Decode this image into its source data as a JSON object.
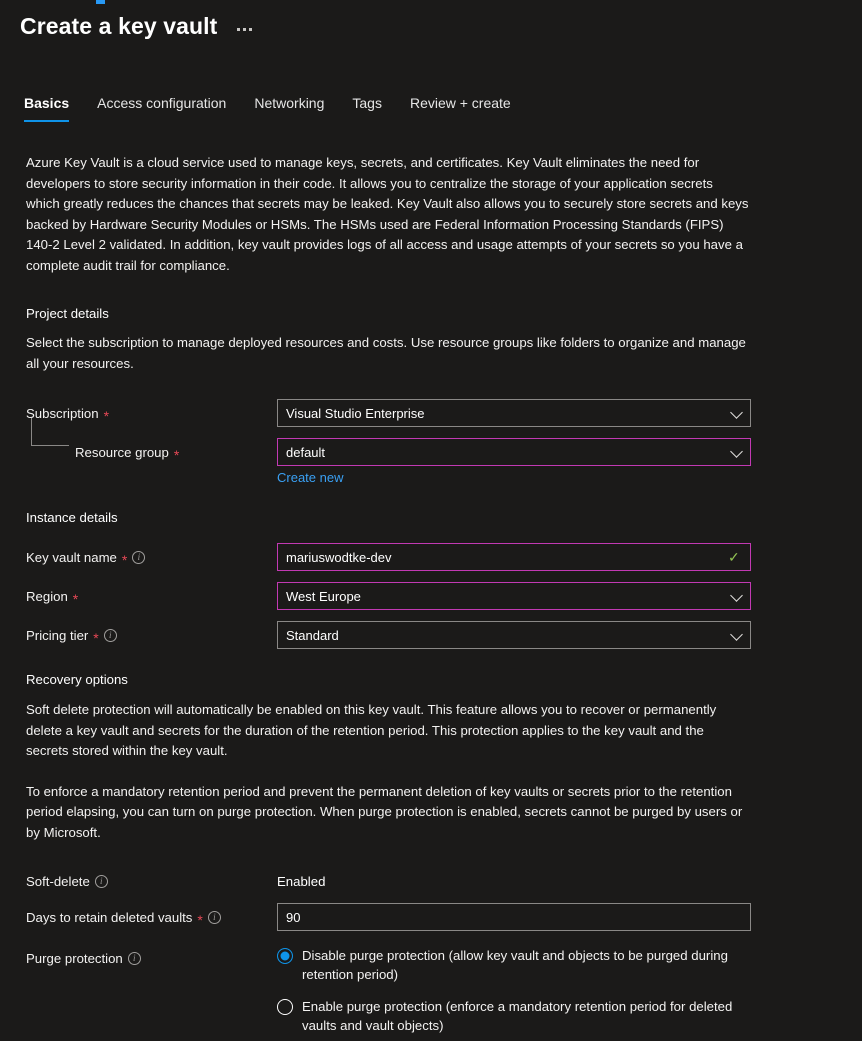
{
  "header": {
    "title": "Create a key vault",
    "more_menu": "..."
  },
  "tabs": [
    {
      "label": "Basics",
      "active": true
    },
    {
      "label": "Access configuration",
      "active": false
    },
    {
      "label": "Networking",
      "active": false
    },
    {
      "label": "Tags",
      "active": false
    },
    {
      "label": "Review + create",
      "active": false
    }
  ],
  "intro": "Azure Key Vault is a cloud service used to manage keys, secrets, and certificates. Key Vault eliminates the need for developers to store security information in their code. It allows you to centralize the storage of your application secrets which greatly reduces the chances that secrets may be leaked. Key Vault also allows you to securely store secrets and keys backed by Hardware Security Modules or HSMs. The HSMs used are Federal Information Processing Standards (FIPS) 140-2 Level 2 validated. In addition, key vault provides logs of all access and usage attempts of your secrets so you have a complete audit trail for compliance.",
  "project_details": {
    "heading": "Project details",
    "description": "Select the subscription to manage deployed resources and costs. Use resource groups like folders to organize and manage all your resources.",
    "subscription": {
      "label": "Subscription",
      "required": "*",
      "value": "Visual Studio Enterprise"
    },
    "resource_group": {
      "label": "Resource group",
      "required": "*",
      "value": "default",
      "create_new_link": "Create new"
    }
  },
  "instance_details": {
    "heading": "Instance details",
    "key_vault_name": {
      "label": "Key vault name",
      "required": "*",
      "value": "mariuswodtke-dev",
      "validation_icon": "check-icon"
    },
    "region": {
      "label": "Region",
      "required": "*",
      "value": "West Europe"
    },
    "pricing_tier": {
      "label": "Pricing tier",
      "required": "*",
      "value": "Standard"
    }
  },
  "recovery_options": {
    "heading": "Recovery options",
    "paragraph_1": "Soft delete protection will automatically be enabled on this key vault. This feature allows you to recover or permanently delete a key vault and secrets for the duration of the retention period. This protection applies to the key vault and the secrets stored within the key vault.",
    "paragraph_2": "To enforce a mandatory retention period and prevent the permanent deletion of key vaults or secrets prior to the retention period elapsing, you can turn on purge protection. When purge protection is enabled, secrets cannot be purged by users or by Microsoft.",
    "soft_delete": {
      "label": "Soft-delete",
      "value": "Enabled"
    },
    "days_to_retain": {
      "label": "Days to retain deleted vaults",
      "required": "*",
      "value": "90"
    },
    "purge_protection": {
      "label": "Purge protection",
      "options": [
        {
          "label": "Disable purge protection (allow key vault and objects to be purged during retention period)",
          "selected": true
        },
        {
          "label": "Enable purge protection (enforce a mandatory retention period for deleted vaults and vault objects)",
          "selected": false
        }
      ]
    }
  },
  "colors": {
    "background": "#1b1a19",
    "accent_blue": "#0f93e8",
    "link_blue": "#3aa0f3",
    "focus_magenta": "#c239b3",
    "required_red": "#e74856",
    "valid_green": "#92c353",
    "border_grey": "#8a8886"
  }
}
